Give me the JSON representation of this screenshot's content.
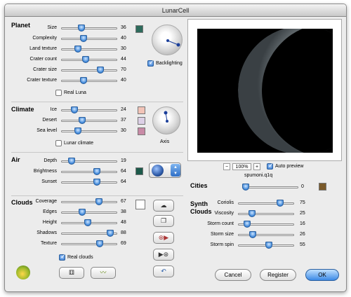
{
  "window": {
    "title": "LunarCell"
  },
  "planet": {
    "heading": "Planet",
    "sliders": [
      {
        "label": "Size",
        "value": "36",
        "pos": 0.36
      },
      {
        "label": "Complexity",
        "value": "40",
        "pos": 0.4
      },
      {
        "label": "Land texture",
        "value": "30",
        "pos": 0.3
      },
      {
        "label": "Crater count",
        "value": "44",
        "pos": 0.44
      },
      {
        "label": "Crater size",
        "value": "70",
        "pos": 0.7
      },
      {
        "label": "Crater texture",
        "value": "40",
        "pos": 0.4
      }
    ],
    "real_luna_label": "Real Luna",
    "backlighting_label": "Backlighting",
    "color_swatch": "#2e6b5c"
  },
  "climate": {
    "heading": "Climate",
    "sliders": [
      {
        "label": "Ice",
        "value": "24",
        "pos": 0.24,
        "color": "#f2c4b8"
      },
      {
        "label": "Desert",
        "value": "37",
        "pos": 0.37,
        "color": "#dcd0e6"
      },
      {
        "label": "Sea level",
        "value": "30",
        "pos": 0.3,
        "color": "#c88aa6"
      }
    ],
    "lunar_climate_label": "Lunar climate",
    "axis_label": "Axis"
  },
  "air": {
    "heading": "Air",
    "sliders": [
      {
        "label": "Depth",
        "value": "19",
        "pos": 0.19
      },
      {
        "label": "Brightness",
        "value": "64",
        "pos": 0.64
      },
      {
        "label": "Sunset",
        "value": "64",
        "pos": 0.64
      }
    ],
    "color_swatch": "#1d5a4a"
  },
  "clouds": {
    "heading": "Clouds",
    "sliders": [
      {
        "label": "Coverage",
        "value": "67",
        "pos": 0.67
      },
      {
        "label": "Edges",
        "value": "38",
        "pos": 0.38
      },
      {
        "label": "Height",
        "value": "48",
        "pos": 0.48
      },
      {
        "label": "Shadows",
        "value": "88",
        "pos": 0.88
      },
      {
        "label": "Texture",
        "value": "69",
        "pos": 0.69
      }
    ],
    "real_clouds_label": "Real clouds",
    "color_swatch": "#ffffff"
  },
  "preview": {
    "zoom": "100%",
    "zoom_minus": "−",
    "zoom_plus": "+",
    "auto_preview_label": "Auto preview",
    "filename": "spumoni.q1q"
  },
  "cities": {
    "heading": "Cities",
    "value": "0",
    "pos": 0.0,
    "color_swatch": "#7a5a2a"
  },
  "synth_clouds": {
    "heading_line1": "Synth",
    "heading_line2": "Clouds",
    "sliders": [
      {
        "label": "Coriolis",
        "value": "75",
        "pos": 0.75
      },
      {
        "label": "Viscosity",
        "value": "25",
        "pos": 0.25
      },
      {
        "label": "Storm count",
        "value": "16",
        "pos": 0.16
      },
      {
        "label": "Storm size",
        "value": "26",
        "pos": 0.26
      },
      {
        "label": "Storm spin",
        "value": "55",
        "pos": 0.55
      }
    ]
  },
  "buttons": {
    "cancel": "Cancel",
    "register": "Register",
    "ok": "OK"
  }
}
